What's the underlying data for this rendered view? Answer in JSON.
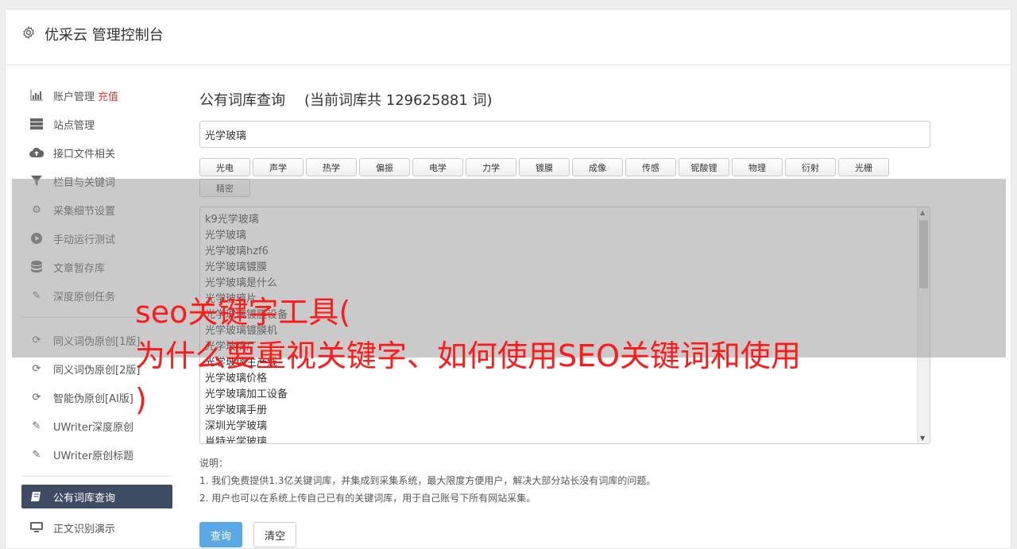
{
  "header": {
    "title": "优采云 管理控制台",
    "icon": "gear-icon"
  },
  "sidebar": {
    "items": [
      {
        "label": "账户管理",
        "badge": "充值",
        "icon": "bar-chart-icon"
      },
      {
        "label": "站点管理",
        "icon": "server-icon"
      },
      {
        "label": "接口文件相关",
        "icon": "cloud-upload-icon"
      },
      {
        "label": "栏目与关键词",
        "icon": "filter-icon"
      },
      {
        "label": "采集细节设置",
        "icon": "cogs-icon"
      },
      {
        "label": "手动运行测试",
        "icon": "play-circle-icon"
      },
      {
        "label": "文章暂存库",
        "icon": "database-icon"
      },
      {
        "label": "深度原创任务",
        "icon": "edit-icon"
      }
    ],
    "items2": [
      {
        "label": "同义词伪原创[1版]",
        "icon": "refresh-icon"
      },
      {
        "label": "同义词伪原创[2版]",
        "icon": "refresh-icon"
      },
      {
        "label": "智能伪原创[AI版]",
        "icon": "refresh-icon"
      },
      {
        "label": "UWriter深度原创",
        "icon": "edit-icon"
      },
      {
        "label": "UWriter原创标题",
        "icon": "edit-icon"
      }
    ],
    "active": {
      "label": "公有词库查询",
      "icon": "book-icon"
    },
    "items3": [
      {
        "label": "正文识别演示",
        "icon": "monitor-icon"
      }
    ]
  },
  "main": {
    "heading": "公有词库查询",
    "count_text": "(当前词库共 129625881 词)",
    "search_value": "光学玻璃",
    "tags": [
      "光电",
      "声学",
      "热学",
      "偏振",
      "电学",
      "力学",
      "镀膜",
      "成像",
      "传感",
      "铌酸锂",
      "物理",
      "衍射",
      "光栅",
      "精密"
    ],
    "results": [
      "k9光学玻璃",
      "光学玻璃",
      "光学玻璃hzf6",
      "光学玻璃镀膜",
      "光学玻璃是什么",
      "光学玻璃片",
      "光学玻璃镀膜设备",
      "光学玻璃镀膜机",
      "光学玻璃厂",
      "光学玻璃生产线",
      "光学玻璃价格",
      "光学玻璃加工设备",
      "光学玻璃手册",
      "深圳光学玻璃",
      "肖特光学玻璃"
    ],
    "notes_title": "说明：",
    "notes": [
      "1. 我们免费提供1.3亿关键词库，并集成到采集系统，最大限度方便用户，解决大部分站长没有词库的问题。",
      "2. 用户也可以在系统上传自己已有的关键词库，用于自己账号下所有网站采集。"
    ],
    "query_button": "查询",
    "clear_button": "清空"
  },
  "overlay": {
    "lines": [
      "seo关键字工具(",
      "为什么要重视关键字、如何使用SEO关键词和使用",
      ")"
    ],
    "color": "#ff1a1a"
  }
}
